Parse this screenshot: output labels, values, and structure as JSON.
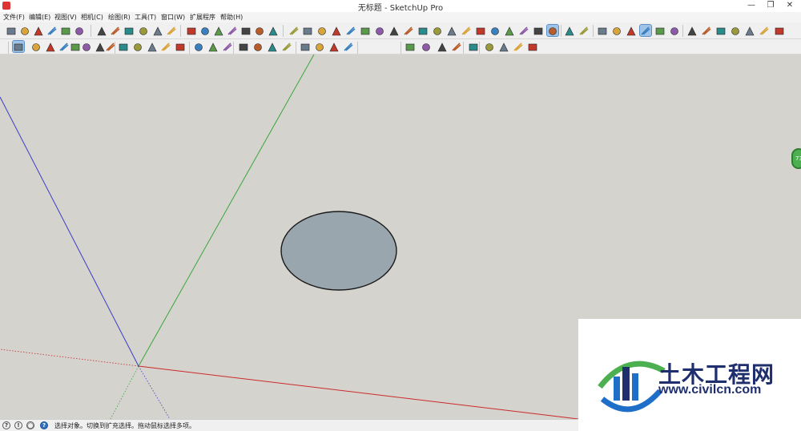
{
  "window": {
    "title": "无标题 - SketchUp Pro",
    "minimize_glyph": "—",
    "restore_glyph": "❐",
    "close_glyph": "✕"
  },
  "menu": [
    {
      "label": "文件(F)"
    },
    {
      "label": "编辑(E)"
    },
    {
      "label": "视图(V)"
    },
    {
      "label": "相机(C)"
    },
    {
      "label": "绘图(R)"
    },
    {
      "label": "工具(T)"
    },
    {
      "label": "窗口(W)"
    },
    {
      "label": "扩展程序"
    },
    {
      "label": "帮助(H)"
    }
  ],
  "status": {
    "text": "选择对象。切换到扩充选择。拖动鼠标选择多项。",
    "info_glyph": "?",
    "alert_glyph": "!",
    "user_glyph": "◯",
    "help_glyph": "?"
  },
  "side_badge": "73",
  "watermark": {
    "title": "土木工程网",
    "url": "www.civilcn.com"
  },
  "colors": {
    "background": "#d4d3ce",
    "circle_fill": "#9aa6ae",
    "axis_red": "#cc2a2a",
    "axis_green": "#3aa63a",
    "axis_blue": "#3c3cc8",
    "active_tool": "#9fc4e8"
  },
  "toolbars": {
    "row1_icons": [
      "get-models-icon",
      "3d-warehouse-icon",
      "home-icon",
      "house-icon",
      "tent-icon",
      "warehouse-icon",
      "sphere-icon",
      "flag-icon",
      "pointer-icon",
      "dome-icon",
      "ball-icon",
      "marker-icon",
      "grid-icon",
      "cube-icon",
      "stairs-icon",
      "blocks-icon",
      "column-icon",
      "ruler-icon",
      "drill-icon",
      "cut-icon",
      "arc-icon",
      "curve-icon",
      "roof-icon",
      "eraser-icon",
      "pencil-icon",
      "chain-icon",
      "angle-icon",
      "box-icon",
      "book-icon",
      "cup-icon",
      "mesh-icon",
      "layers-icon",
      "window-icon",
      "stack-icon",
      "line-icon",
      "solid-icon",
      "tag-icon",
      "wire-icon",
      "render-icon",
      "panel-icon",
      "cube-sides-icon",
      "face-icon",
      "paint-icon",
      "section-icon",
      "style-icon",
      "gold-icon",
      "diamond-icon",
      "blue-ball-icon",
      "r-icon",
      "rt-icon",
      "br-icon",
      "globe-icon",
      "tools-icon"
    ],
    "row2_icons": [
      "select-arrow-icon",
      "eraser-icon",
      "pencil-line-icon",
      "dropdown-icon",
      "arc-tool-icon",
      "dropdown-icon",
      "shape-tool-icon",
      "dropdown-icon",
      "push-pull-icon",
      "move-icon",
      "rotate-icon",
      "scale-icon",
      "offset-icon",
      "tape-measure-icon",
      "text-label-icon",
      "paint-bucket-icon",
      "orbit-icon",
      "pan-icon",
      "zoom-icon",
      "zoom-extents-icon",
      "scenes-icon",
      "components-icon",
      "materials-icon",
      "print-icon",
      "layers-toggle-icon",
      "sandbox-icon",
      "terrain-icon",
      "smooth-icon",
      "freehand-icon",
      "stamp-icon",
      "drape-icon",
      "add-detail-icon",
      "flip-edge-icon"
    ]
  }
}
